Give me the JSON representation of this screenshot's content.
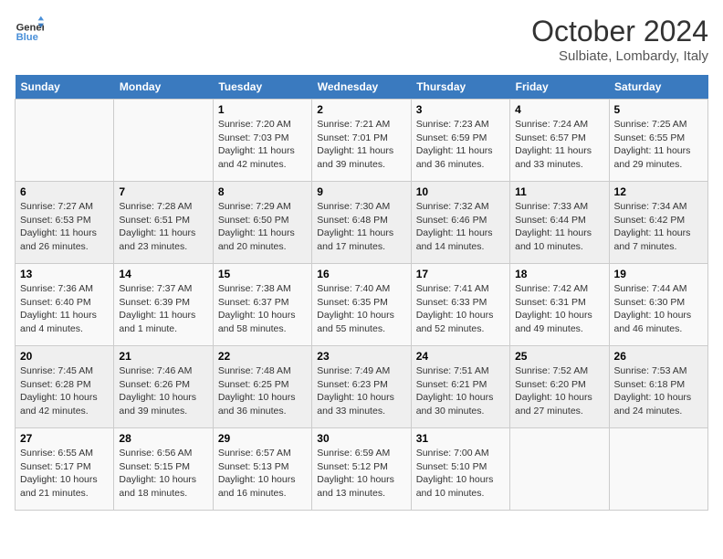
{
  "header": {
    "logo_general": "General",
    "logo_blue": "Blue",
    "month": "October 2024",
    "location": "Sulbiate, Lombardy, Italy"
  },
  "days_of_week": [
    "Sunday",
    "Monday",
    "Tuesday",
    "Wednesday",
    "Thursday",
    "Friday",
    "Saturday"
  ],
  "weeks": [
    [
      {
        "day": "",
        "info": ""
      },
      {
        "day": "",
        "info": ""
      },
      {
        "day": "1",
        "info": "Sunrise: 7:20 AM\nSunset: 7:03 PM\nDaylight: 11 hours and 42 minutes."
      },
      {
        "day": "2",
        "info": "Sunrise: 7:21 AM\nSunset: 7:01 PM\nDaylight: 11 hours and 39 minutes."
      },
      {
        "day": "3",
        "info": "Sunrise: 7:23 AM\nSunset: 6:59 PM\nDaylight: 11 hours and 36 minutes."
      },
      {
        "day": "4",
        "info": "Sunrise: 7:24 AM\nSunset: 6:57 PM\nDaylight: 11 hours and 33 minutes."
      },
      {
        "day": "5",
        "info": "Sunrise: 7:25 AM\nSunset: 6:55 PM\nDaylight: 11 hours and 29 minutes."
      }
    ],
    [
      {
        "day": "6",
        "info": "Sunrise: 7:27 AM\nSunset: 6:53 PM\nDaylight: 11 hours and 26 minutes."
      },
      {
        "day": "7",
        "info": "Sunrise: 7:28 AM\nSunset: 6:51 PM\nDaylight: 11 hours and 23 minutes."
      },
      {
        "day": "8",
        "info": "Sunrise: 7:29 AM\nSunset: 6:50 PM\nDaylight: 11 hours and 20 minutes."
      },
      {
        "day": "9",
        "info": "Sunrise: 7:30 AM\nSunset: 6:48 PM\nDaylight: 11 hours and 17 minutes."
      },
      {
        "day": "10",
        "info": "Sunrise: 7:32 AM\nSunset: 6:46 PM\nDaylight: 11 hours and 14 minutes."
      },
      {
        "day": "11",
        "info": "Sunrise: 7:33 AM\nSunset: 6:44 PM\nDaylight: 11 hours and 10 minutes."
      },
      {
        "day": "12",
        "info": "Sunrise: 7:34 AM\nSunset: 6:42 PM\nDaylight: 11 hours and 7 minutes."
      }
    ],
    [
      {
        "day": "13",
        "info": "Sunrise: 7:36 AM\nSunset: 6:40 PM\nDaylight: 11 hours and 4 minutes."
      },
      {
        "day": "14",
        "info": "Sunrise: 7:37 AM\nSunset: 6:39 PM\nDaylight: 11 hours and 1 minute."
      },
      {
        "day": "15",
        "info": "Sunrise: 7:38 AM\nSunset: 6:37 PM\nDaylight: 10 hours and 58 minutes."
      },
      {
        "day": "16",
        "info": "Sunrise: 7:40 AM\nSunset: 6:35 PM\nDaylight: 10 hours and 55 minutes."
      },
      {
        "day": "17",
        "info": "Sunrise: 7:41 AM\nSunset: 6:33 PM\nDaylight: 10 hours and 52 minutes."
      },
      {
        "day": "18",
        "info": "Sunrise: 7:42 AM\nSunset: 6:31 PM\nDaylight: 10 hours and 49 minutes."
      },
      {
        "day": "19",
        "info": "Sunrise: 7:44 AM\nSunset: 6:30 PM\nDaylight: 10 hours and 46 minutes."
      }
    ],
    [
      {
        "day": "20",
        "info": "Sunrise: 7:45 AM\nSunset: 6:28 PM\nDaylight: 10 hours and 42 minutes."
      },
      {
        "day": "21",
        "info": "Sunrise: 7:46 AM\nSunset: 6:26 PM\nDaylight: 10 hours and 39 minutes."
      },
      {
        "day": "22",
        "info": "Sunrise: 7:48 AM\nSunset: 6:25 PM\nDaylight: 10 hours and 36 minutes."
      },
      {
        "day": "23",
        "info": "Sunrise: 7:49 AM\nSunset: 6:23 PM\nDaylight: 10 hours and 33 minutes."
      },
      {
        "day": "24",
        "info": "Sunrise: 7:51 AM\nSunset: 6:21 PM\nDaylight: 10 hours and 30 minutes."
      },
      {
        "day": "25",
        "info": "Sunrise: 7:52 AM\nSunset: 6:20 PM\nDaylight: 10 hours and 27 minutes."
      },
      {
        "day": "26",
        "info": "Sunrise: 7:53 AM\nSunset: 6:18 PM\nDaylight: 10 hours and 24 minutes."
      }
    ],
    [
      {
        "day": "27",
        "info": "Sunrise: 6:55 AM\nSunset: 5:17 PM\nDaylight: 10 hours and 21 minutes."
      },
      {
        "day": "28",
        "info": "Sunrise: 6:56 AM\nSunset: 5:15 PM\nDaylight: 10 hours and 18 minutes."
      },
      {
        "day": "29",
        "info": "Sunrise: 6:57 AM\nSunset: 5:13 PM\nDaylight: 10 hours and 16 minutes."
      },
      {
        "day": "30",
        "info": "Sunrise: 6:59 AM\nSunset: 5:12 PM\nDaylight: 10 hours and 13 minutes."
      },
      {
        "day": "31",
        "info": "Sunrise: 7:00 AM\nSunset: 5:10 PM\nDaylight: 10 hours and 10 minutes."
      },
      {
        "day": "",
        "info": ""
      },
      {
        "day": "",
        "info": ""
      }
    ]
  ]
}
